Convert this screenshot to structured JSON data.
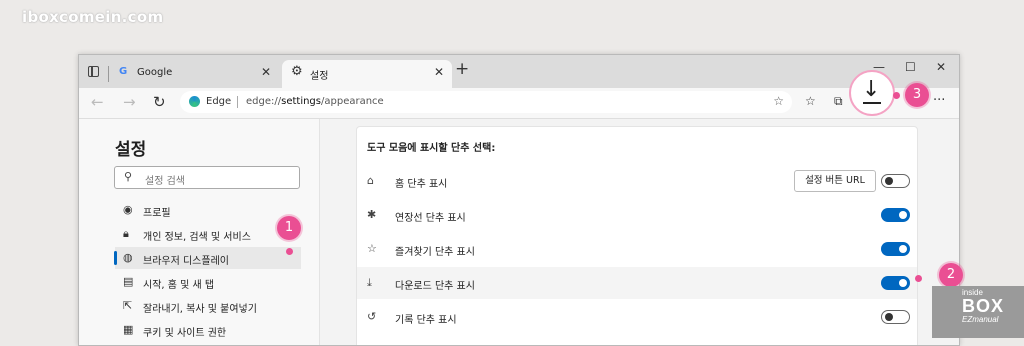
{
  "watermark": "iboxcomein.com",
  "tabs": [
    {
      "label": "Google"
    },
    {
      "label": "설정"
    }
  ],
  "window_controls": {
    "minimize": "—",
    "maximize": "☐",
    "close": "✕"
  },
  "address_bar": {
    "site_label": "Edge",
    "url_prefix": "edge://",
    "url_bold": "settings",
    "url_suffix": "/appearance"
  },
  "sidebar": {
    "title": "설정",
    "search_placeholder": "설정 검색",
    "items": [
      {
        "label": "프로필",
        "icon": "profile-icon"
      },
      {
        "label": "개인 정보, 검색 및 서비스",
        "icon": "lock-icon"
      },
      {
        "label": "브라우저 디스플레이",
        "icon": "palette-icon",
        "selected": true
      },
      {
        "label": "시작, 홈 및 새 탭",
        "icon": "start-icon"
      },
      {
        "label": "잘라내기, 복사 및 붙여넣기",
        "icon": "share-icon"
      },
      {
        "label": "쿠키 및 사이트 권한",
        "icon": "cookie-icon"
      }
    ]
  },
  "content": {
    "section_title": "도구 모음에 표시할 단추 선택:",
    "home_url_button": "설정 버튼 URL",
    "rows": [
      {
        "label": "홈 단추 표시",
        "icon": "home-icon",
        "on": false
      },
      {
        "label": "연장선 단추 표시",
        "icon": "extension-icon",
        "on": true
      },
      {
        "label": "즐겨찾기 단추 표시",
        "icon": "favorites-icon",
        "on": true
      },
      {
        "label": "다운로드 단추 표시",
        "icon": "download-icon",
        "on": true
      },
      {
        "label": "기록 단추 표시",
        "icon": "history-icon",
        "on": false
      }
    ]
  },
  "callouts": [
    "1",
    "2",
    "3"
  ],
  "logo": {
    "line1": "inside",
    "line2": "BOX",
    "line3": "EZmanual"
  },
  "colors": {
    "accent": "#0067c0",
    "callout": "#ea4f93"
  }
}
